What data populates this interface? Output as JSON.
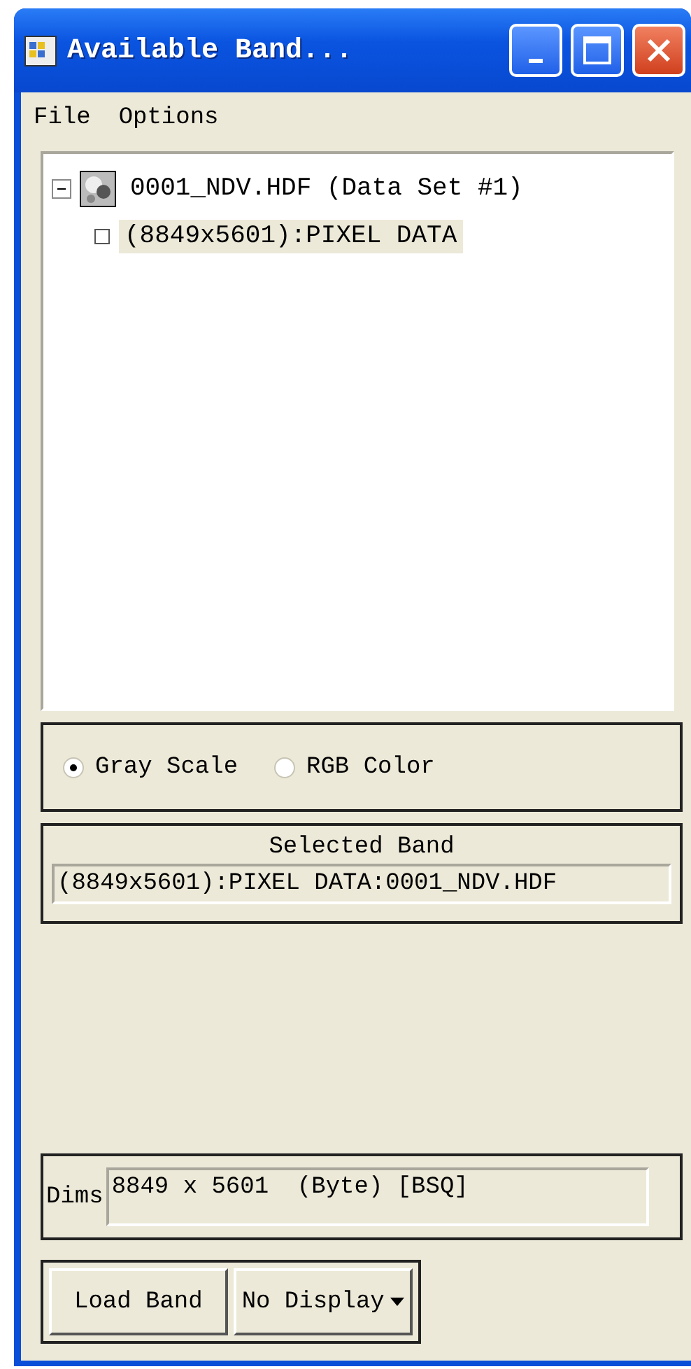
{
  "window": {
    "title": "Available Band..."
  },
  "menu": [
    {
      "label": "File"
    },
    {
      "label": "Options"
    }
  ],
  "tree": [
    {
      "label": "0001_NDV.HDF (Data Set #1)",
      "expanded": true,
      "selected": false,
      "children": [
        {
          "label": "(8849x5601):PIXEL DATA",
          "selected": true
        }
      ]
    }
  ],
  "color_mode": [
    {
      "label": "Gray Scale",
      "selected": true
    },
    {
      "label": "RGB Color",
      "selected": false
    }
  ],
  "selected_band": {
    "title": "Selected Band",
    "value": "(8849x5601):PIXEL DATA:0001_NDV.HDF"
  },
  "dims": {
    "label": "Dims",
    "value": "8849 x 5601  (Byte) [BSQ]"
  },
  "buttons": [
    {
      "label": "Load Band",
      "kind": "button"
    },
    {
      "label": "No Display",
      "kind": "dropdown"
    }
  ]
}
